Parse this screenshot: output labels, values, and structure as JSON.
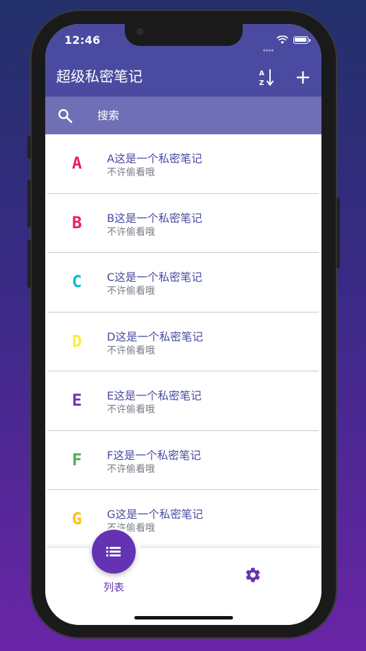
{
  "status_bar": {
    "time": "12:46"
  },
  "app_bar": {
    "title": "超级私密笔记",
    "sort_icon": "sort-alpha-icon",
    "add_icon": "plus-icon"
  },
  "search": {
    "placeholder": "搜索",
    "icon": "search-icon"
  },
  "notes": [
    {
      "letter": "A",
      "color": "#e91e63",
      "title": "A这是一个私密笔记",
      "subtitle": "不许偷看哦"
    },
    {
      "letter": "B",
      "color": "#e91e63",
      "title": "B这是一个私密笔记",
      "subtitle": "不许偷看哦"
    },
    {
      "letter": "C",
      "color": "#00bcd4",
      "title": "C这是一个私密笔记",
      "subtitle": "不许偷看哦"
    },
    {
      "letter": "D",
      "color": "#ffeb3b",
      "title": "D这是一个私密笔记",
      "subtitle": "不许偷看哦"
    },
    {
      "letter": "E",
      "color": "#673ab7",
      "title": "E这是一个私密笔记",
      "subtitle": "不许偷看哦"
    },
    {
      "letter": "F",
      "color": "#4caf50",
      "title": "F这是一个私密笔记",
      "subtitle": "不许偷看哦"
    },
    {
      "letter": "G",
      "color": "#ffc107",
      "title": "G这是一个私密笔记",
      "subtitle": "不许偷看哦"
    }
  ],
  "bottom_nav": {
    "list_label": "列表",
    "list_icon": "list-icon",
    "settings_icon": "gear-icon",
    "accent": "#6433b3"
  },
  "colors": {
    "primary": "#4a4ba0",
    "search_bg": "#6e6fb4"
  }
}
